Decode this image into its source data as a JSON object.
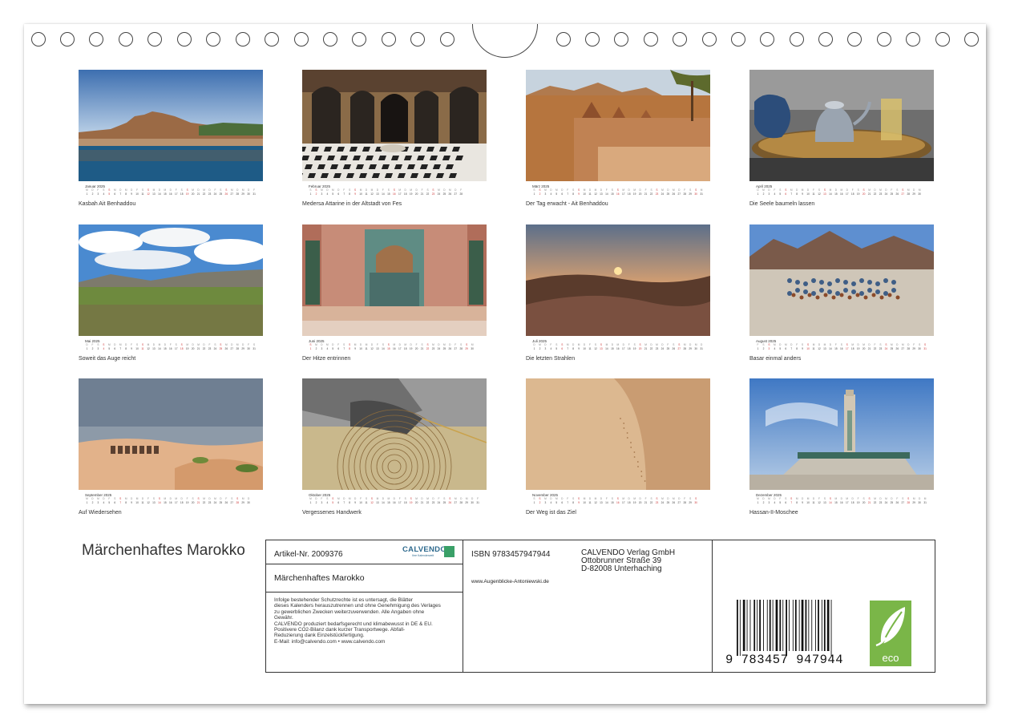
{
  "calendar_title": "Märchenhaftes Marokko",
  "weekday_header": [
    "M",
    "D",
    "M",
    "D",
    "F",
    "S",
    "S",
    "M",
    "D",
    "M",
    "D",
    "F",
    "S",
    "S",
    "M",
    "D",
    "M",
    "D",
    "F",
    "S",
    "S",
    "M",
    "D",
    "M",
    "D",
    "F",
    "S",
    "S",
    "M",
    "D",
    "M"
  ],
  "months": [
    {
      "name": "Januar 2025",
      "caption": "Kasbah Ait Benhaddou",
      "scene": "kasbah-river"
    },
    {
      "name": "Februar 2025",
      "caption": "Medersa Attarine in der Altstadt von Fes",
      "scene": "medersa"
    },
    {
      "name": "März 2025",
      "caption": "Der Tag erwacht - Ait Benhaddou",
      "scene": "rooftops"
    },
    {
      "name": "April 2025",
      "caption": "Die Seele baumeln lassen",
      "scene": "teapot"
    },
    {
      "name": "Mai 2025",
      "caption": "Soweit das Auge reicht",
      "scene": "meadow"
    },
    {
      "name": "Juni 2025",
      "caption": "Der Hitze entrinnen",
      "scene": "fountain"
    },
    {
      "name": "Juli 2025",
      "caption": "Die letzten Strahlen",
      "scene": "sunset"
    },
    {
      "name": "August 2025",
      "caption": "Basar einmal anders",
      "scene": "bazaar"
    },
    {
      "name": "September 2025",
      "caption": "Auf Wiedersehen",
      "scene": "camels"
    },
    {
      "name": "Oktober 2025",
      "caption": "Vergessenes Handwerk",
      "scene": "craft"
    },
    {
      "name": "November 2025",
      "caption": "Der Weg ist das Ziel",
      "scene": "dune"
    },
    {
      "name": "Dezember 2025",
      "caption": "Hassan-II-Moschee",
      "scene": "mosque"
    }
  ],
  "info": {
    "article": "Artikel-Nr. 2009376",
    "publisher_logo": "CALVENDO",
    "publisher_logo_sub": "Ihre Kalenderwelt",
    "title": "Märchenhaftes Marokko",
    "legal_lines": [
      "Infolge bestehender Schutzrechte ist es untersagt, die Blätter",
      "dieses Kalenders herauszutrennen und ohne Genehmigung des Verlages",
      "zu gewerblichen Zwecken weiterzuverwenden. Alle Angaben ohne",
      "Gewähr.",
      "CALVENDO produziert bedarfsgerecht und klimabewusst in DE & EU.",
      "Positivere CO2-Bilanz dank kurzer Transportwege. Abfall-",
      "Reduzierung dank Einzelstückfertigung.",
      "E-Mail: info@calvendo.com • www.calvendo.com"
    ],
    "isbn": "ISBN 9783457947944",
    "website": "www.Augenblicke-Antoniewski.de",
    "publisher_lines": [
      "CALVENDO Verlag GmbH",
      "Ottobrunner Straße 39",
      "D-82008 Unterhaching"
    ],
    "barcode_number": "9 783457 947944",
    "eco_label": "eco"
  },
  "colors": {
    "calvendo_blue": "#2e6a8e",
    "eco_green": "#7ab648",
    "weekend_red": "#cc3333"
  }
}
